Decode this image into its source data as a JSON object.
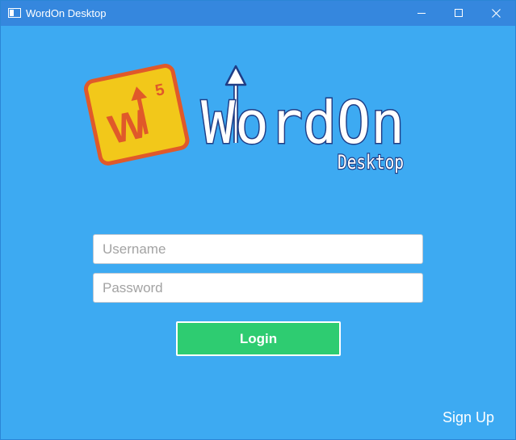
{
  "window": {
    "title": "WordOn Desktop",
    "controls": [
      "minimize",
      "maximize",
      "close"
    ]
  },
  "logo": {
    "tile_letter": "W",
    "tile_score": "5",
    "wordmark": "WordOn",
    "subtitle": "Desktop"
  },
  "form": {
    "username_placeholder": "Username",
    "username_value": "",
    "password_placeholder": "Password",
    "password_value": "",
    "login_label": "Login"
  },
  "footer": {
    "signup_label": "Sign Up"
  },
  "colors": {
    "background": "#3daaf2",
    "titlebar": "#3587de",
    "tile_fill": "#f2c81a",
    "tile_border": "#e0592a",
    "wordmark_outline": "#1f3d86",
    "login_button": "#2ecc71"
  }
}
